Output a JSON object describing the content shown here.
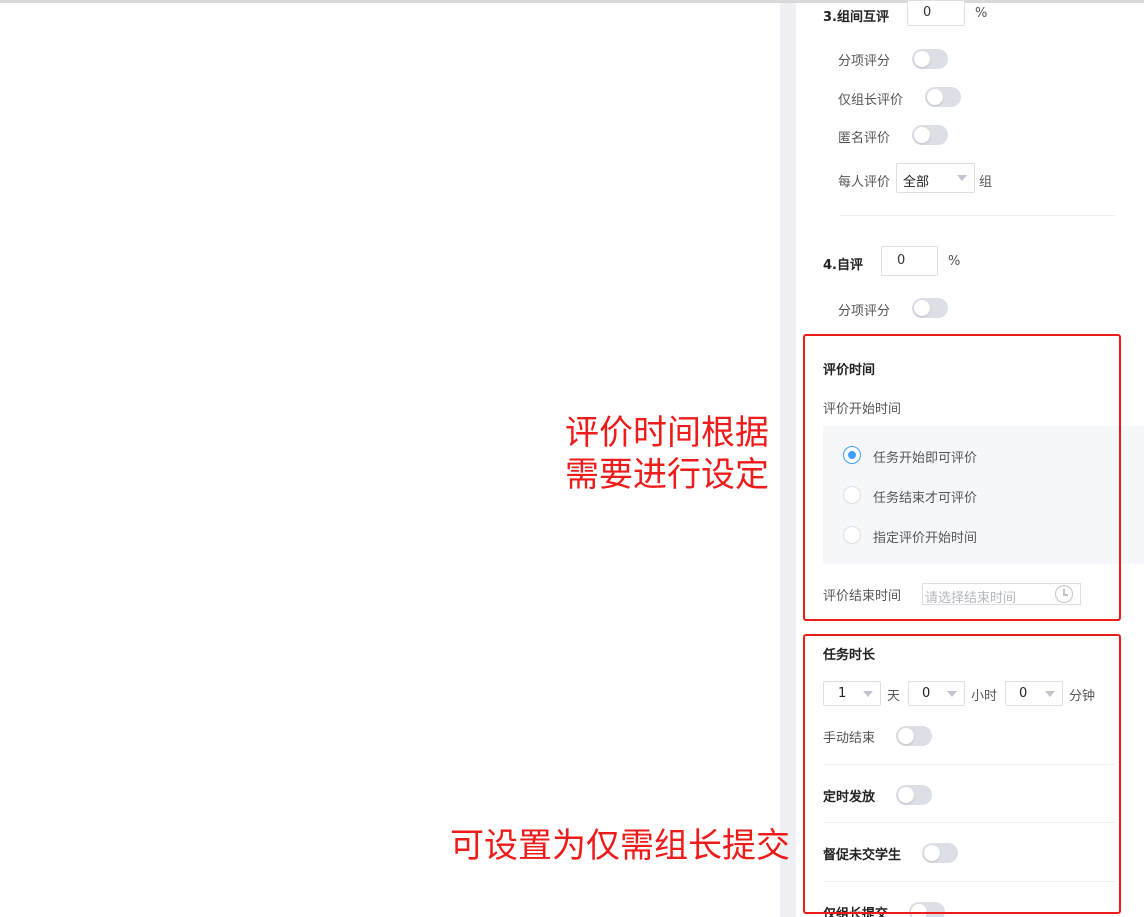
{
  "peer_group": {
    "title": "3.组间互评",
    "percent_value": "0",
    "percent_unit": "%",
    "toggles": [
      {
        "label": "分项评分",
        "on": false
      },
      {
        "label": "仅组长评价",
        "on": false
      },
      {
        "label": "匿名评价",
        "on": false
      }
    ],
    "per_person_label": "每人评价",
    "per_person_value": "全部",
    "per_person_unit": "组"
  },
  "self_eval": {
    "title": "4.自评",
    "percent_value": "0",
    "percent_unit": "%",
    "toggle_label": "分项评分",
    "toggle_on": false
  },
  "eval_time": {
    "title": "评价时间",
    "start_label": "评价开始时间",
    "options": [
      {
        "label": "任务开始即可评价",
        "selected": true
      },
      {
        "label": "任务结束才可评价",
        "selected": false
      },
      {
        "label": "指定评价开始时间",
        "selected": false
      }
    ],
    "end_label": "评价结束时间",
    "end_placeholder": "请选择结束时间"
  },
  "task_duration": {
    "title": "任务时长",
    "days_value": "1",
    "days_unit": "天",
    "hours_value": "0",
    "hours_unit": "小时",
    "minutes_value": "0",
    "minutes_unit": "分钟",
    "manual_end_label": "手动结束",
    "manual_end_on": false
  },
  "scheduled_release": {
    "label": "定时发放",
    "on": false
  },
  "remind_students": {
    "label": "督促未交学生",
    "on": false
  },
  "leader_submit": {
    "label": "仅组长提交",
    "on": false
  },
  "annotations": {
    "eval_time_line1": "评价时间根据",
    "eval_time_line2": "需要进行设定",
    "leader_submit_note": "可设置为仅需组长提交"
  },
  "colors": {
    "accent": "#409eff",
    "annotation_red": "#ee1b1b",
    "toggle_off": "#dcdfe6"
  }
}
